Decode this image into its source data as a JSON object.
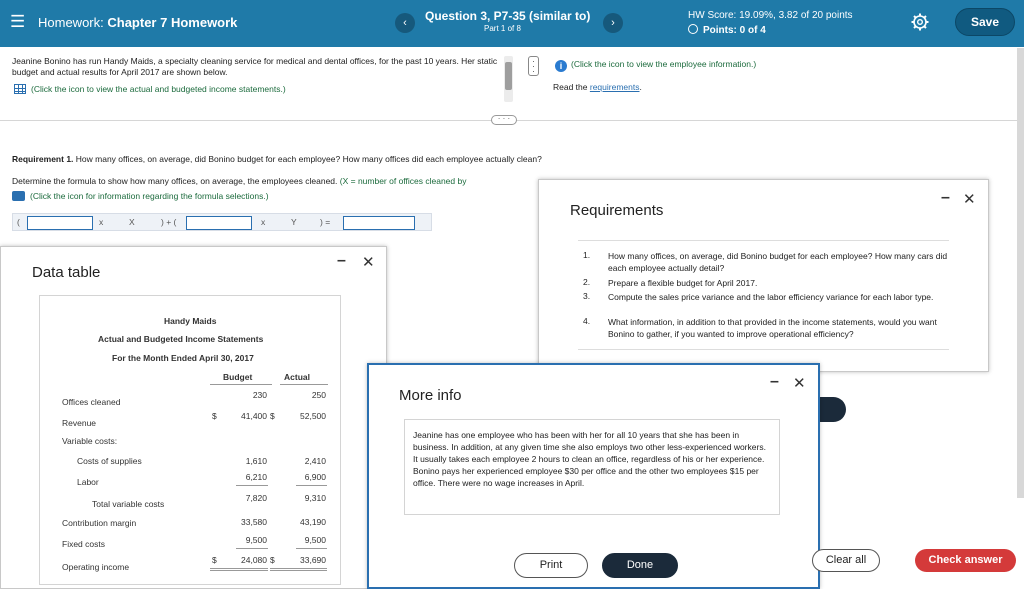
{
  "header": {
    "menu_icon": "hamburger-icon",
    "homework_prefix": "Homework:",
    "homework_title": "Chapter 7 Homework",
    "question_title": "Question 3, P7-35 (similar to)",
    "question_part": "Part 1 of 8",
    "prev_icon": "‹",
    "next_icon": "›",
    "hw_score": "HW Score: 19.09%, 3.82 of 20 points",
    "points": "Points: 0 of 4",
    "save_label": "Save"
  },
  "question": {
    "intro": "Jeanine Bonino has run Handy Maids, a specialty cleaning service for medical and dental offices, for the past 10 years. Her static budget and actual results for April 2017 are shown below.",
    "table_link": "(Click the icon to view the actual and budgeted income statements.)",
    "employee_link": "(Click the icon to view the employee information.)",
    "read_prefix": "Read the ",
    "read_link": "requirements",
    "read_suffix": ".",
    "requirement_label": "Requirement 1.",
    "requirement_text": " How many offices, on average, did Bonino budget for each employee? How many offices did each employee actually clean?",
    "determine_text": "Determine the formula to show how many offices, on average, the employees cleaned.",
    "determine_hint": " (X = number of offices cleaned by",
    "formula_link": "(Click the icon for information regarding the formula selections.)",
    "formula": {
      "open": "(",
      "x": "x",
      "X": "X",
      "mid": ") + (",
      "x2": "x",
      "Y": "Y",
      "close": ") ="
    }
  },
  "data_table": {
    "title": "Data table",
    "company": "Handy Maids",
    "subtitle": "Actual and Budgeted Income Statements",
    "period": "For the Month Ended April 30, 2017",
    "col_budget": "Budget",
    "col_actual": "Actual",
    "rows": [
      {
        "label": "Offices cleaned",
        "budget": "230",
        "actual": "250"
      },
      {
        "label": "Revenue",
        "cur_b": "$",
        "budget": "41,400",
        "cur_a": "$",
        "actual": "52,500"
      },
      {
        "label": "Variable costs:",
        "budget": "",
        "actual": ""
      },
      {
        "label": "Costs of supplies",
        "budget": "1,610",
        "actual": "2,410"
      },
      {
        "label": "Labor",
        "budget": "6,210",
        "actual": "6,900"
      },
      {
        "label": "Total variable costs",
        "budget": "7,820",
        "actual": "9,310"
      },
      {
        "label": "Contribution margin",
        "budget": "33,580",
        "actual": "43,190"
      },
      {
        "label": "Fixed costs",
        "budget": "9,500",
        "actual": "9,500"
      },
      {
        "label": "Operating income",
        "cur_b": "$",
        "budget": "24,080",
        "cur_a": "$",
        "actual": "33,690"
      }
    ]
  },
  "requirements": {
    "title": "Requirements",
    "items": [
      {
        "num": "1.",
        "text": "How many offices, on average, did Bonino budget for each employee? How many cars did each employee actually detail?"
      },
      {
        "num": "2.",
        "text": "Prepare a flexible budget for April 2017."
      },
      {
        "num": "3.",
        "text": "Compute the sales price variance and the labor efficiency variance for each labor type."
      },
      {
        "num": "4.",
        "text": "What information, in addition to that provided in the income statements, would you want Bonino to gather, if you wanted to improve operational efficiency?"
      }
    ]
  },
  "more_info": {
    "title": "More info",
    "text": "Jeanine has one employee who has been with her for all 10 years that she has been in business. In addition, at any given time she also employs two other less-experienced workers. It usually takes each employee 2 hours to clean an office, regardless of his or her experience. Bonino pays her experienced employee $30 per office and the other two employees $15 per office. There were no wage increases in April.",
    "print_label": "Print",
    "done_label": "Done"
  },
  "footer": {
    "clear_all": "Clear all",
    "check_answer": "Check answer"
  },
  "colors": {
    "header_bg": "#1f7aa8",
    "check_answer": "#d43a3a",
    "done_bg": "#1b2a3a",
    "link_green": "#1c6b3d"
  }
}
